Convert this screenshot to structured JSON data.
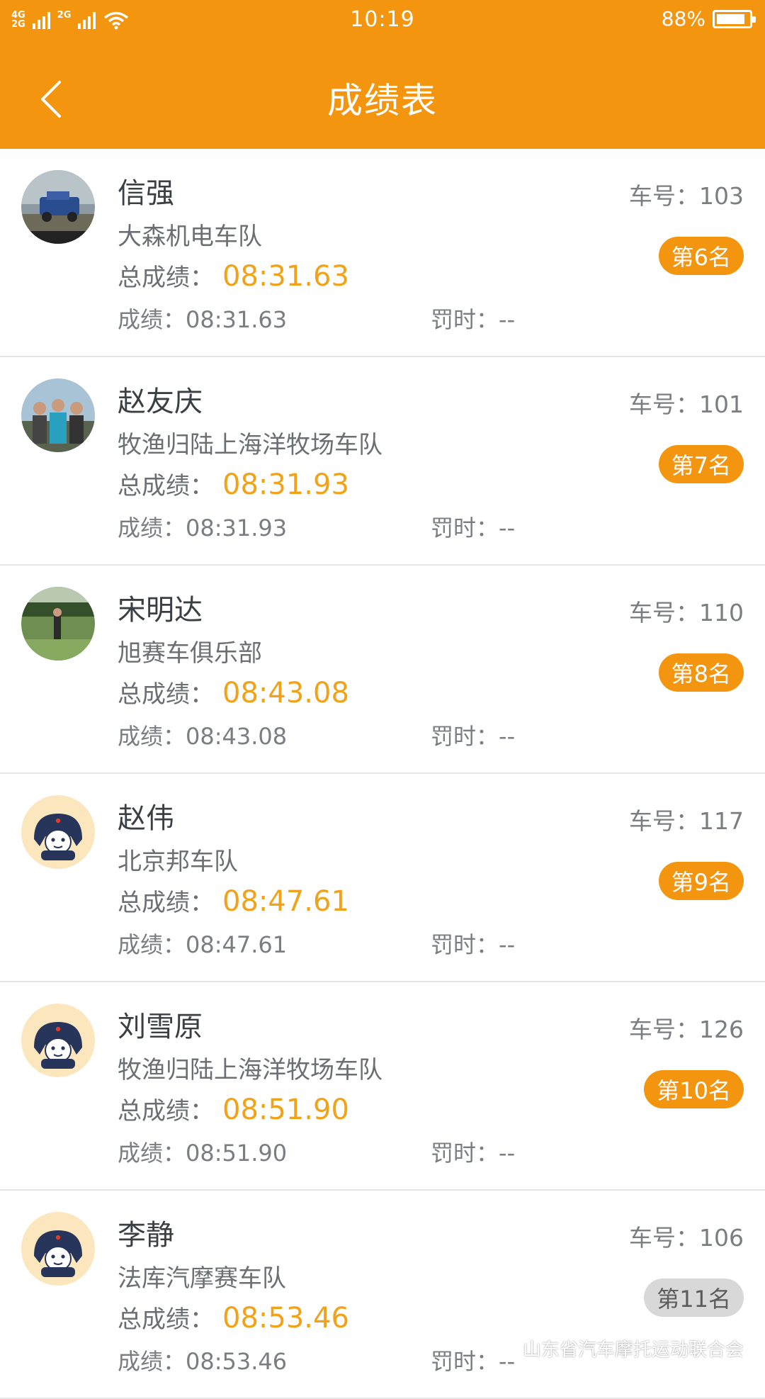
{
  "status_bar": {
    "network_top": "4G",
    "network_bottom": "2G",
    "network_extra": "2G",
    "time": "10:19",
    "battery_percent": "88%",
    "battery_level": 0.88
  },
  "nav": {
    "title": "成绩表",
    "back_icon": "chevron-left-icon"
  },
  "labels": {
    "total_label": "总成绩：",
    "score_label": "成绩：",
    "penalty_label": "罚时：",
    "carno_label": "车号："
  },
  "entries": [
    {
      "name": "信强",
      "team": "大森机电车队",
      "car_no": "103",
      "total": "08:31.63",
      "score": "08:31.63",
      "penalty": "--",
      "rank": "第6名",
      "rank_style": "orange",
      "avatar": "photo-car"
    },
    {
      "name": "赵友庆",
      "team": "牧渔归陆上海洋牧场车队",
      "car_no": "101",
      "total": "08:31.93",
      "score": "08:31.93",
      "penalty": "--",
      "rank": "第7名",
      "rank_style": "orange",
      "avatar": "photo-people"
    },
    {
      "name": "宋明达",
      "team": "旭赛车俱乐部",
      "car_no": "110",
      "total": "08:43.08",
      "score": "08:43.08",
      "penalty": "--",
      "rank": "第8名",
      "rank_style": "orange",
      "avatar": "photo-field"
    },
    {
      "name": "赵伟",
      "team": "北京邦车队",
      "car_no": "117",
      "total": "08:47.61",
      "score": "08:47.61",
      "penalty": "--",
      "rank": "第9名",
      "rank_style": "orange",
      "avatar": "default-face"
    },
    {
      "name": "刘雪原",
      "team": "牧渔归陆上海洋牧场车队",
      "car_no": "126",
      "total": "08:51.90",
      "score": "08:51.90",
      "penalty": "--",
      "rank": "第10名",
      "rank_style": "orange",
      "avatar": "default-face"
    },
    {
      "name": "李静",
      "team": "法库汽摩赛车队",
      "car_no": "106",
      "total": "08:53.46",
      "score": "08:53.46",
      "penalty": "--",
      "rank": "第11名",
      "rank_style": "grey",
      "avatar": "default-face"
    }
  ],
  "watermark": {
    "text": "山东省汽车摩托运动联合会",
    "icon": "wechat-icon"
  },
  "colors": {
    "accent": "#F3950F",
    "total_value": "#F0A31A",
    "grey_badge": "#d8d8d8"
  }
}
